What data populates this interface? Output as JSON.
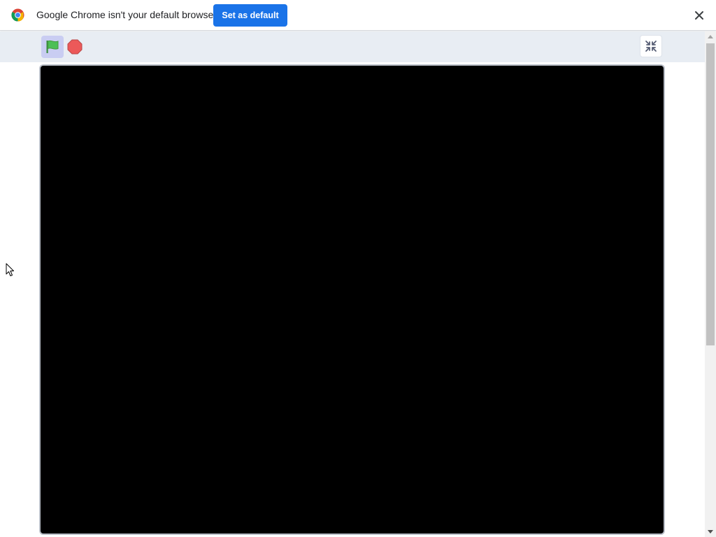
{
  "infobar": {
    "message": "Google Chrome isn't your default browser",
    "button_label": "Set as default",
    "logo_icon": "chrome-logo-icon",
    "close_icon": "close-icon"
  },
  "player": {
    "green_flag_icon": "green-flag-icon",
    "stop_icon": "stop-sign-icon",
    "unfullscreen_icon": "exit-fullscreen-icon",
    "stage_color": "#000000"
  },
  "colors": {
    "accent": "#1a73e8",
    "toolbar_bg": "#e8edf3",
    "flag_button_bg": "#c9cdf2",
    "flag_green": "#4cbf56",
    "stop_red": "#ec5959"
  }
}
